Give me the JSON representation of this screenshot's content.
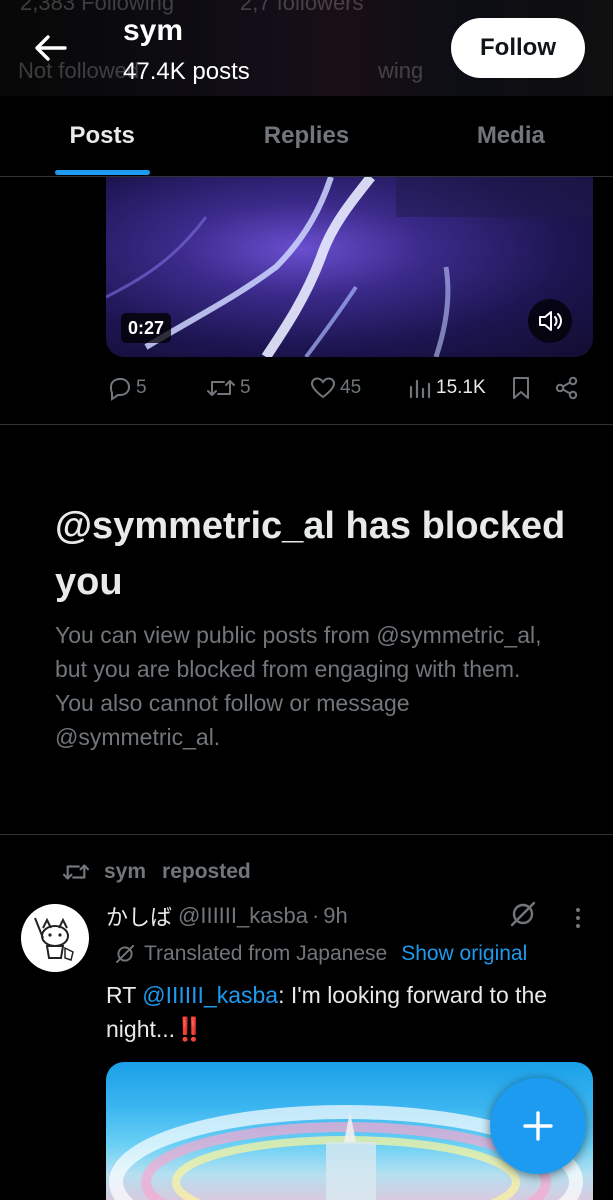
{
  "header": {
    "name": "sym",
    "posts_count": "47.4K posts",
    "follow_label": "Follow",
    "ghost_following": "2,383 Following",
    "ghost_followers": "2,7 followers",
    "ghost_not_followed": "Not followed",
    "ghost_wing": "wing"
  },
  "tabs": [
    {
      "label": "Posts",
      "active": true
    },
    {
      "label": "Replies",
      "active": false
    },
    {
      "label": "Media",
      "active": false
    }
  ],
  "video": {
    "duration": "0:27"
  },
  "actions": {
    "replies": "5",
    "reposts": "5",
    "likes": "45",
    "views": "15.1K"
  },
  "blocked": {
    "title": "@symmetric_al has blocked you",
    "body": "You can view public posts from @symmetric_al, but you are blocked from engaging with them. You also cannot follow or message @symmetric_al."
  },
  "repost": {
    "name": "sym",
    "label": "reposted"
  },
  "post": {
    "display_name": "かしば",
    "handle": "@IIIIII_kasba",
    "dot": "·",
    "time": "9h",
    "translated": "Translated from Japanese",
    "show_original": "Show original",
    "text_prefix": "RT ",
    "mention": "@IIIIII_kasba",
    "text_body": ": I'm looking forward to the night...",
    "emoji": "‼️"
  },
  "colors": {
    "accent": "#1d9bf0",
    "muted": "#71767b",
    "background": "#000000",
    "divider": "#2f3336"
  }
}
